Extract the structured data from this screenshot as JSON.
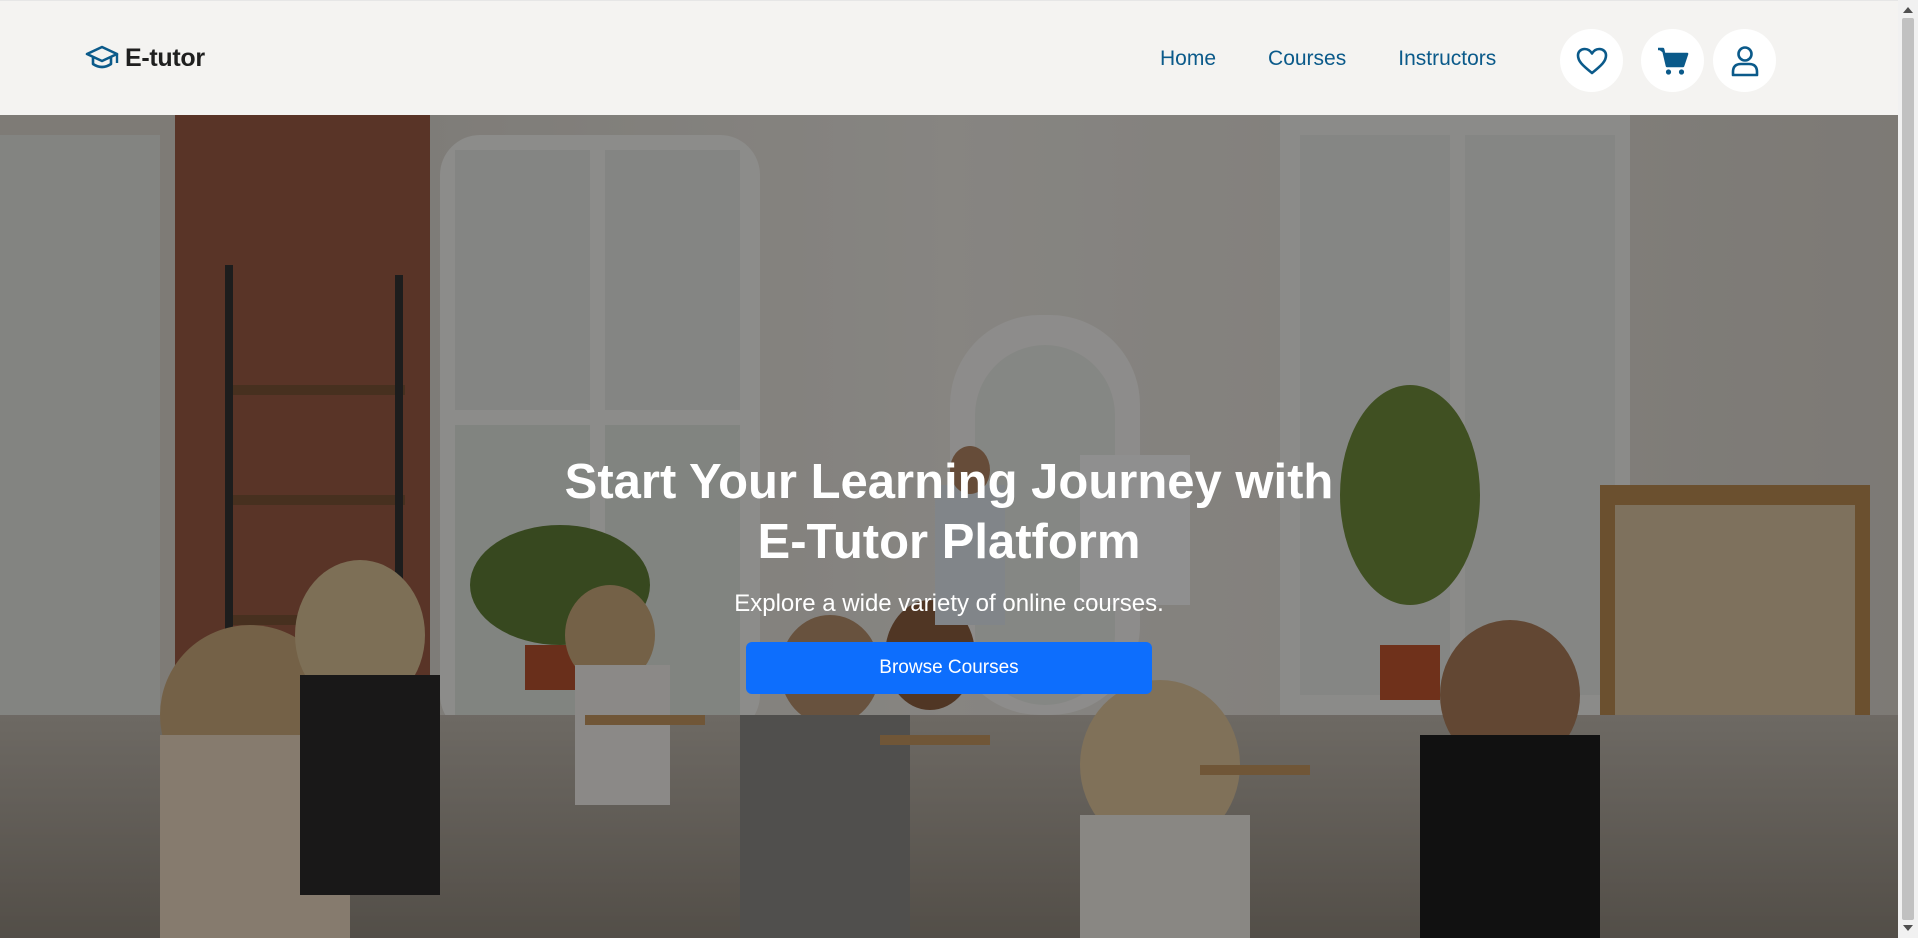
{
  "brand": {
    "name": "E-tutor",
    "icon": "graduation-cap-icon"
  },
  "nav": {
    "links": [
      {
        "label": "Home"
      },
      {
        "label": "Courses"
      },
      {
        "label": "Instructors"
      }
    ],
    "actions": [
      {
        "icon": "heart-icon"
      },
      {
        "icon": "cart-icon"
      },
      {
        "icon": "user-icon"
      }
    ]
  },
  "hero": {
    "title_line1": "Start Your Learning Journey with",
    "title_line2": "E-Tutor Platform",
    "subtitle": "Explore a wide variety of online courses.",
    "cta_label": "Browse Courses",
    "background": "classroom-photo"
  },
  "colors": {
    "nav_link": "#0b5a8a",
    "primary_button": "#0d6efd",
    "navbar_bg": "#f4f3f1"
  }
}
